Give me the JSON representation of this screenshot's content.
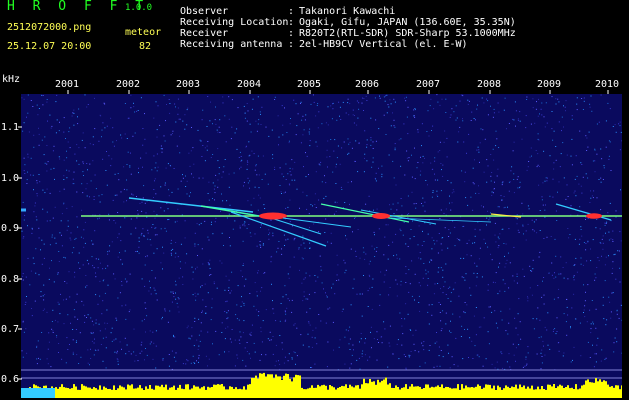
{
  "header": {
    "app_name": "H R O F F T",
    "version": "1.0.0",
    "filename": "2512072000.png",
    "meteor_label": "meteor",
    "datetime": "25.12.07 20:00",
    "meteor_count": "82"
  },
  "info": [
    {
      "key": "Observer",
      "sep": ":",
      "value": "Takanori Kawachi"
    },
    {
      "key": "Receiving Location",
      "sep": ":",
      "value": "Ogaki, Gifu, JAPAN (136.60E, 35.35N)"
    },
    {
      "key": "Receiver",
      "sep": ":",
      "value": "R820T2(RTL-SDR) SDR-Sharp 53.1000MHz"
    },
    {
      "key": "Receiving antenna",
      "sep": ":",
      "value": "2el-HB9CV Vertical (el. E-W)"
    }
  ],
  "axis": {
    "y_unit": "kHz",
    "y_ticks": [
      "1.1",
      "1.0",
      "0.9",
      "0.8",
      "0.7",
      "0.6"
    ],
    "x_ticks": [
      "2001",
      "2002",
      "2003",
      "2004",
      "2005",
      "2006",
      "2007",
      "2008",
      "2009",
      "2010"
    ]
  },
  "colors": {
    "background": "#000000",
    "spectrum_bg": "#0a0a5e",
    "carrier": "#7fff7f",
    "echo_core": "#ff3030",
    "bars": "#ffff00",
    "text_green": "#22ff22",
    "text_yellow": "#ffff55"
  }
}
